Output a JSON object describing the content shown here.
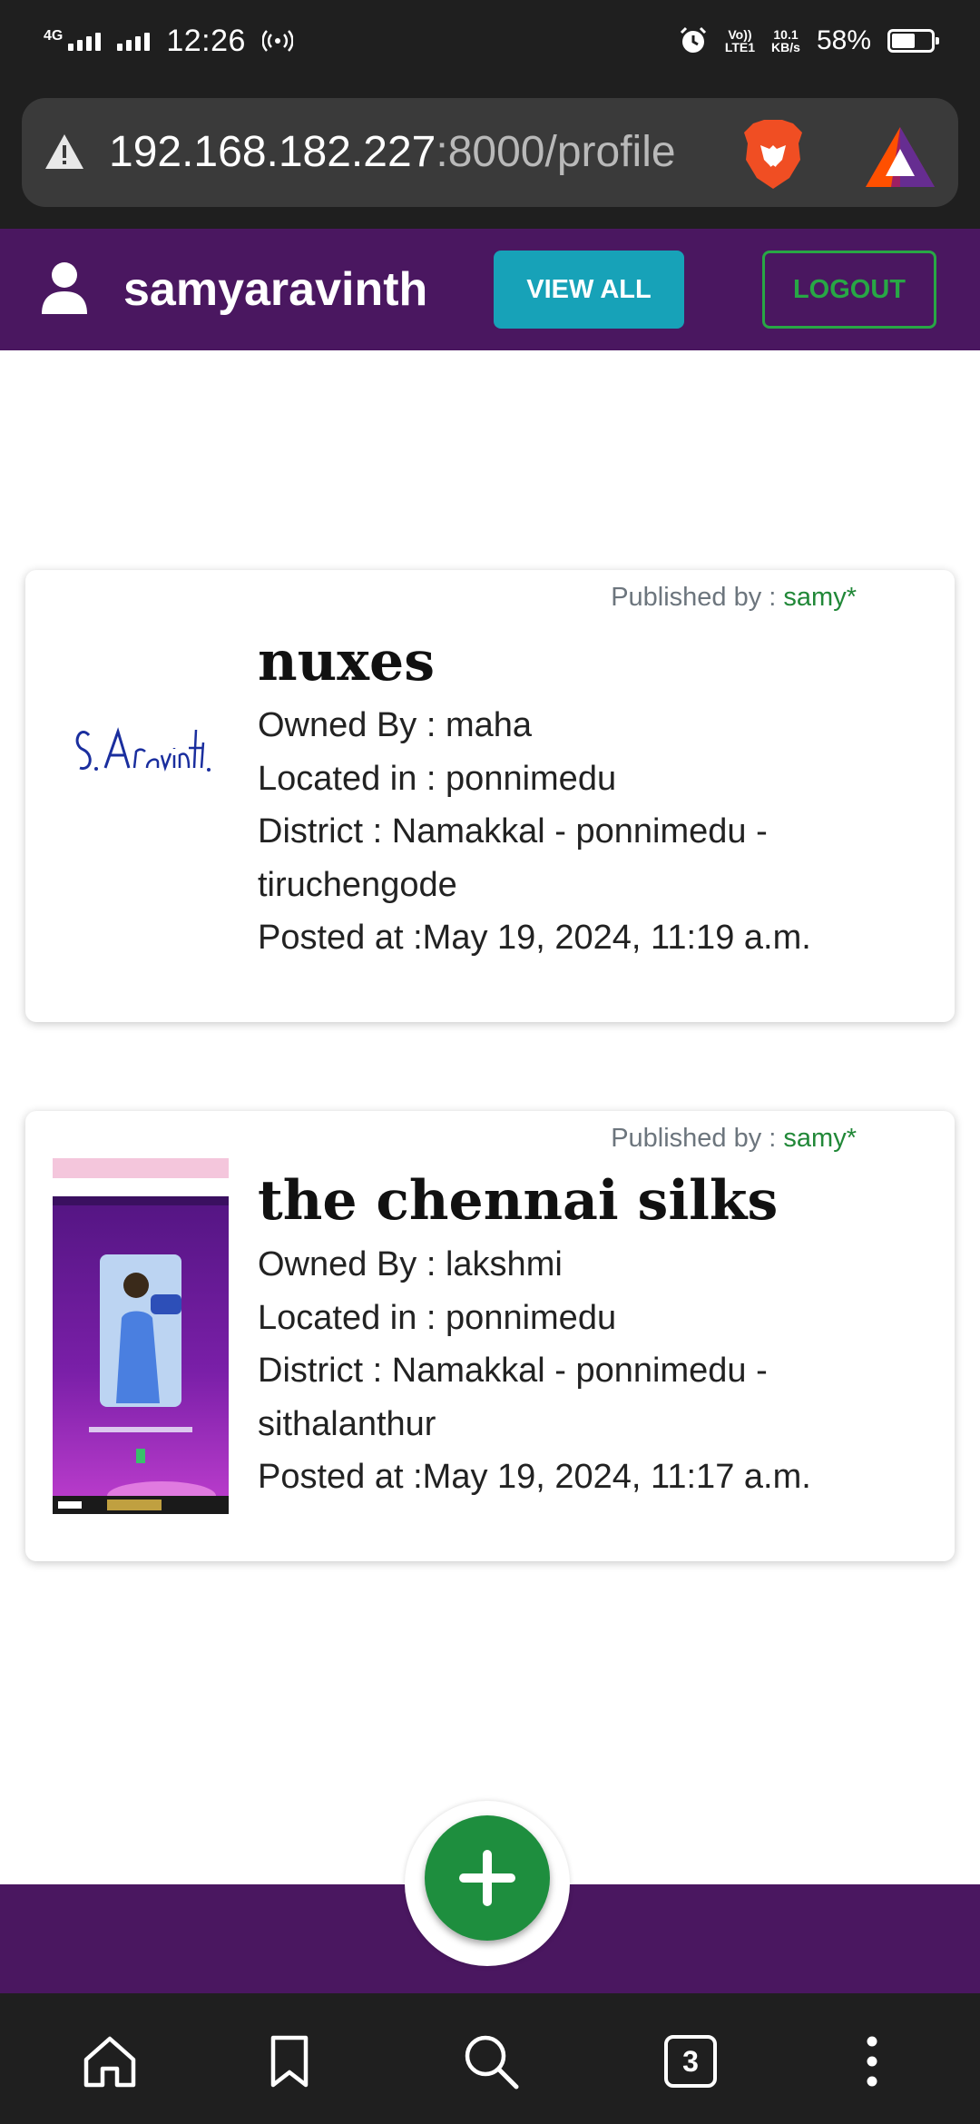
{
  "status_bar": {
    "network": "4G",
    "time": "12:26",
    "volte_top": "Vo))",
    "volte_bottom": "LTE1",
    "speed_top": "10.1",
    "speed_bottom": "KB/s",
    "battery_percent": "58%",
    "battery_level": 0.58
  },
  "browser": {
    "url_host": "192.168.182.227",
    "url_path": ":8000/profile",
    "tab_count": "3",
    "icons": [
      "warning-icon",
      "brave-lion-icon",
      "bat-rewards-icon",
      "home-icon",
      "bookmark-icon",
      "search-icon",
      "tabs-icon",
      "more-icon"
    ]
  },
  "header": {
    "username": "samyaravinth",
    "view_all_label": "VIEW ALL",
    "logout_label": "LOGOUT",
    "colors": {
      "bar": "#4a1760",
      "view_all": "#17a2b8",
      "logout": "#28a745"
    }
  },
  "listings": [
    {
      "published_prefix": "Published by : ",
      "published_by": "samy*",
      "title": "nuxes",
      "owner_label": "Owned By : ",
      "owner": "maha",
      "located_label": "Located in : ",
      "located": "ponnimedu",
      "district_label": "District : ",
      "district": "Namakkal - ponnimedu - tiruchengode",
      "posted_label": "Posted at :",
      "posted": "May 19, 2024, 11:19 a.m.",
      "image": "signature-image"
    },
    {
      "published_prefix": "Published by : ",
      "published_by": "samy*",
      "title": "the chennai silks",
      "owner_label": "Owned By : ",
      "owner": "lakshmi",
      "located_label": "Located in : ",
      "located": "ponnimedu",
      "district_label": "District : ",
      "district": "Namakkal - ponnimedu - sithalanthur",
      "posted_label": "Posted at :",
      "posted": "May 19, 2024, 11:17 a.m.",
      "image": "screenshot-thumbnail"
    }
  ],
  "fab": {
    "icon": "plus-icon",
    "color": "#1e8e3e"
  }
}
